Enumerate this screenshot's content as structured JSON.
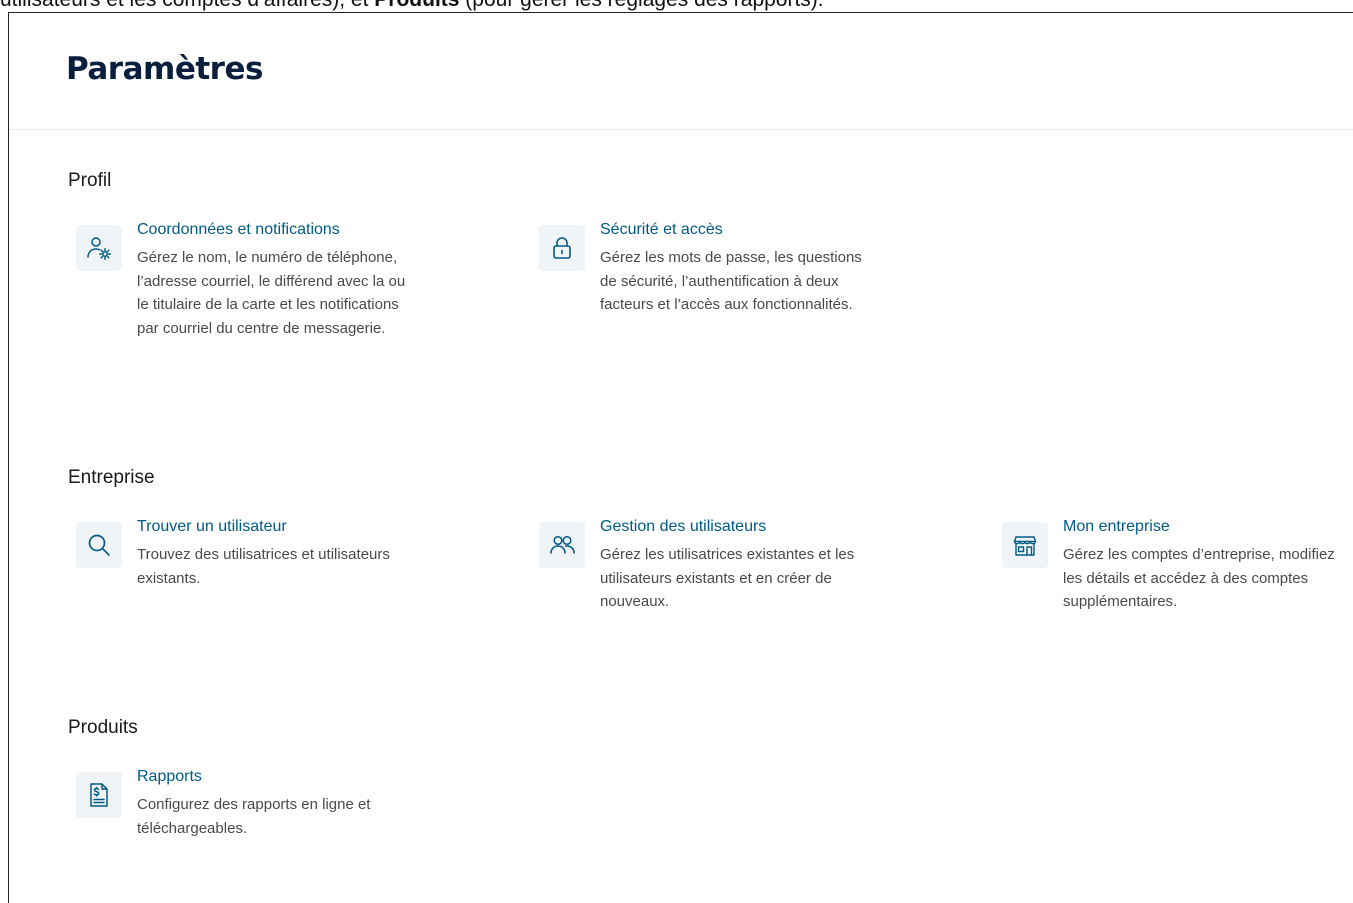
{
  "doc_snippet": {
    "before": "utilisateurs et les comptes d’affaires), et ",
    "bold": "Produits",
    "after": " (pour gérer les réglages des rapports)."
  },
  "page": {
    "title": "Paramètres"
  },
  "sections": {
    "profil": {
      "title": "Profil",
      "cards": [
        {
          "icon": "user-gear-icon",
          "title": "Coordonnées et notifications",
          "description": "Gérez le nom, le numéro de téléphone, l’adresse courriel, le différend avec la ou le titulaire de la carte et les notifications par courriel du centre de messagerie."
        },
        {
          "icon": "lock-icon",
          "title": "Sécurité et accès",
          "description": "Gérez les mots de passe, les questions de sécurité, l’authentification à deux facteurs et l’accès aux fonctionnalités."
        }
      ]
    },
    "entreprise": {
      "title": "Entreprise",
      "cards": [
        {
          "icon": "search-icon",
          "title": "Trouver un utilisateur",
          "description": "Trouvez des utilisatrices et utilisateurs existants."
        },
        {
          "icon": "users-icon",
          "title": "Gestion des utilisateurs",
          "description": "Gérez les utilisatrices existantes et les utilisateurs existants et en créer de nouveaux."
        },
        {
          "icon": "storefront-icon",
          "title": "Mon entreprise",
          "description": "Gérez les comptes d’entreprise, modifiez les détails et accédez à des comptes supplémentaires."
        }
      ]
    },
    "produits": {
      "title": "Produits",
      "cards": [
        {
          "icon": "report-dollar-icon",
          "title": "Rapports",
          "description": "Configurez des rapports en ligne et téléchargeables."
        }
      ]
    }
  },
  "colors": {
    "link": "#005b85",
    "title": "#0a1f3d",
    "icon": "#005b85",
    "icon_bg": "#f1f4f6"
  }
}
